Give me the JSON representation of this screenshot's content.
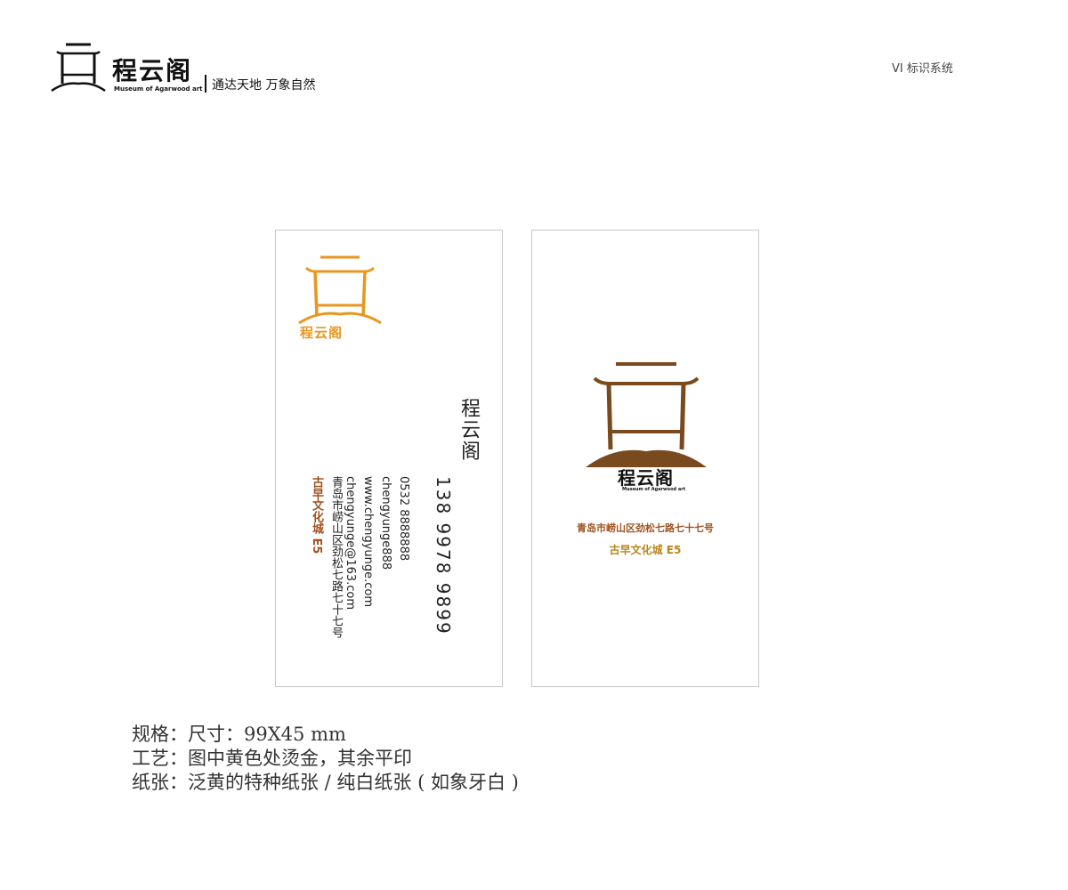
{
  "header": {
    "brand_cn": "程云阁",
    "brand_en": "Museum of Agarwood art",
    "slogan": "通达天地  万象自然",
    "section_label": "VI 标识系统"
  },
  "card_front": {
    "logo_name": "程云阁",
    "name": "程云阁",
    "mobile": "138 9978 9899",
    "tel": "0532 8888888",
    "email": "chengyunge888",
    "website": "www.chengyunge.com",
    "email2": "chengyunge@163.com",
    "address": "青岛市崂山区劲松七路七十七号",
    "city": "古早文化城 E5"
  },
  "card_back": {
    "logo_name": "程云阁",
    "logo_en": "Museum of Agarwood art",
    "address": "青岛市崂山区劲松七路七十七号",
    "city": "古早文化城 E5"
  },
  "specs": [
    {
      "label": "规格：",
      "value": "尺寸：99X45 mm"
    },
    {
      "label": "工艺：",
      "value": "图中黄色处烫金，其余平印"
    },
    {
      "label": "纸张：",
      "value": "泛黄的特种纸张 / 纯白纸张 ( 如象牙白 )"
    }
  ],
  "colors": {
    "gold": "#e9961f",
    "brown": "#7a4a1f",
    "rust": "#a0521e",
    "border": "#c8c8c8"
  }
}
